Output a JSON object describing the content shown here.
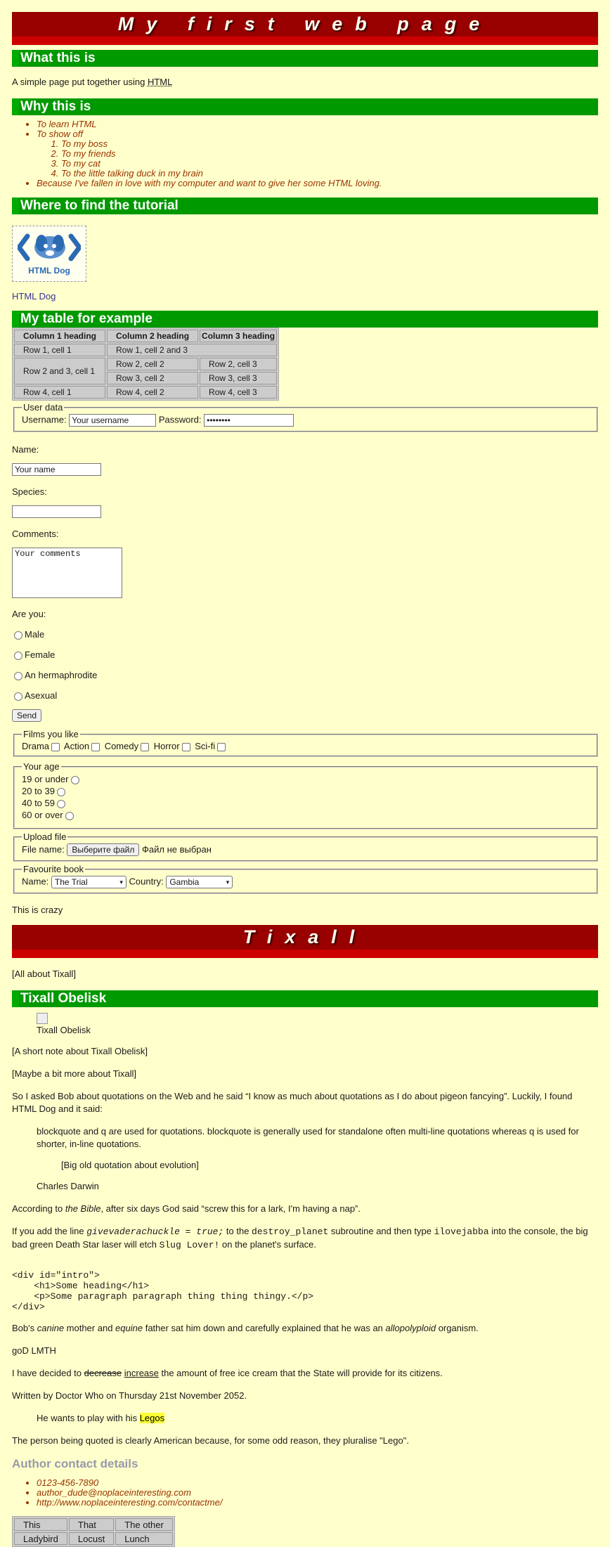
{
  "headings": {
    "page_title": "My first web page",
    "what": "What this is",
    "why": "Why this is",
    "where": "Where to find the tutorial",
    "table": "My table for example",
    "tixall": "Tixall",
    "obelisk": "Tixall Obelisk",
    "contact": "Author contact details"
  },
  "what_text_prefix": "A simple page put together using ",
  "what_text_abbr": "HTML",
  "why_list": {
    "item1": "To learn HTML",
    "item2": "To show off",
    "sub": [
      "To my boss",
      "To my friends",
      "To my cat",
      "To the little talking duck in my brain"
    ],
    "item3": "Because I've fallen in love with my computer and want to give her some HTML loving."
  },
  "logo_text": "HTML Dog",
  "tutorial_link": "HTML Dog",
  "table1": {
    "headers": [
      "Column 1 heading",
      "Column 2 heading",
      "Column 3 heading"
    ],
    "r1c1": "Row 1, cell 1",
    "r1c23": "Row 1, cell 2 and 3",
    "r23c1": "Row 2 and 3, cell 1",
    "r2c2": "Row 2, cell 2",
    "r2c3": "Row 2, cell 3",
    "r3c2": "Row 3, cell 2",
    "r3c3": "Row 3, cell 3",
    "r4c1": "Row 4, cell 1",
    "r4c2": "Row 4, cell 2",
    "r4c3": "Row 4, cell 3"
  },
  "form": {
    "user_legend": "User data",
    "username_label": "Username:",
    "username_value": "Your username",
    "password_label": "Password:",
    "password_value": "••••••••",
    "name_label": "Name:",
    "name_value": "Your name",
    "species_label": "Species:",
    "species_value": "",
    "comments_label": "Comments:",
    "comments_value": "Your comments",
    "are_you": "Are you:",
    "genders": [
      "Male",
      "Female",
      "An hermaphrodite",
      "Asexual"
    ],
    "send": "Send",
    "films_legend": "Films you like",
    "films": [
      "Drama",
      "Action",
      "Comedy",
      "Horror",
      "Sci-fi"
    ],
    "age_legend": "Your age",
    "ages": [
      "19 or under",
      "20 to 39",
      "40 to 59",
      "60 or over"
    ],
    "upload_legend": "Upload file",
    "file_label": "File name:",
    "file_button": "Выберите файл",
    "file_status": "Файл не выбран",
    "book_legend": "Favourite book",
    "book_name_label": "Name:",
    "book_name_value": "The Trial",
    "country_label": "Country:",
    "country_value": "Gambia"
  },
  "crazy": "This is crazy",
  "all_about": "[All about Tixall]",
  "obelisk_caption": "Tixall Obelisk",
  "short_note": "[A short note about Tixall Obelisk]",
  "bit_more": "[Maybe a bit more about Tixall]",
  "bob_text": "So I asked Bob about quotations on the Web and he said “I know as much about quotations as I do about pigeon fancying”. Luckily, I found HTML Dog and it said:",
  "blockquote1": "blockquote and q are used for quotations. blockquote is generally used for standalone often multi-line quotations whereas q is used for shorter, in-line quotations.",
  "blockquote2": "[Big old quotation about evolution]",
  "darwin": "Charles Darwin",
  "bible": {
    "pre": "According to ",
    "cite": "the Bible",
    "post": ", after six days God said “screw this for a lark, I'm having a nap”."
  },
  "code_para": {
    "t1": "If you add the line ",
    "c1": "givevaderachuckle = true;",
    "t2": " to the ",
    "c2": "destroy_planet",
    "t3": " subroutine and then type ",
    "c3": "ilovejabba",
    "t4": " into the console, the big bad green Death Star laser will etch ",
    "c4": "Slug Lover!",
    "t5": " on the planet's surface."
  },
  "pre_block": "<div id=\"intro\">\n    <h1>Some heading</h1>\n    <p>Some paragraph paragraph thing thing thingy.</p>\n</div>",
  "bob_canine": {
    "t1": "Bob's ",
    "e1": "canine",
    "t2": " mother and ",
    "e2": "equine",
    "t3": " father sat him down and carefully explained that he was an ",
    "e3": "allopolyploid",
    "t4": " organism."
  },
  "god": "goD LMTH",
  "icecream": {
    "t1": "I have decided to ",
    "del": "decrease",
    "ins": "increase",
    "t2": " the amount of free ice cream that the State will provide for its citizens."
  },
  "doctor": "Written by Doctor Who on Thursday 21st November 2052.",
  "legos": {
    "t1": "He wants to play with his ",
    "mark": "Legos"
  },
  "american": "The person being quoted is clearly American because, for some odd reason, they pluralise \"Lego\".",
  "contact": [
    "0123-456-7890",
    "author_dude@noplaceinteresting.com",
    "http://www.noplaceinteresting.com/contactme/"
  ],
  "table2": [
    [
      "This",
      "That",
      "The other"
    ],
    [
      "Ladybird",
      "Locust",
      "Lunch"
    ]
  ]
}
